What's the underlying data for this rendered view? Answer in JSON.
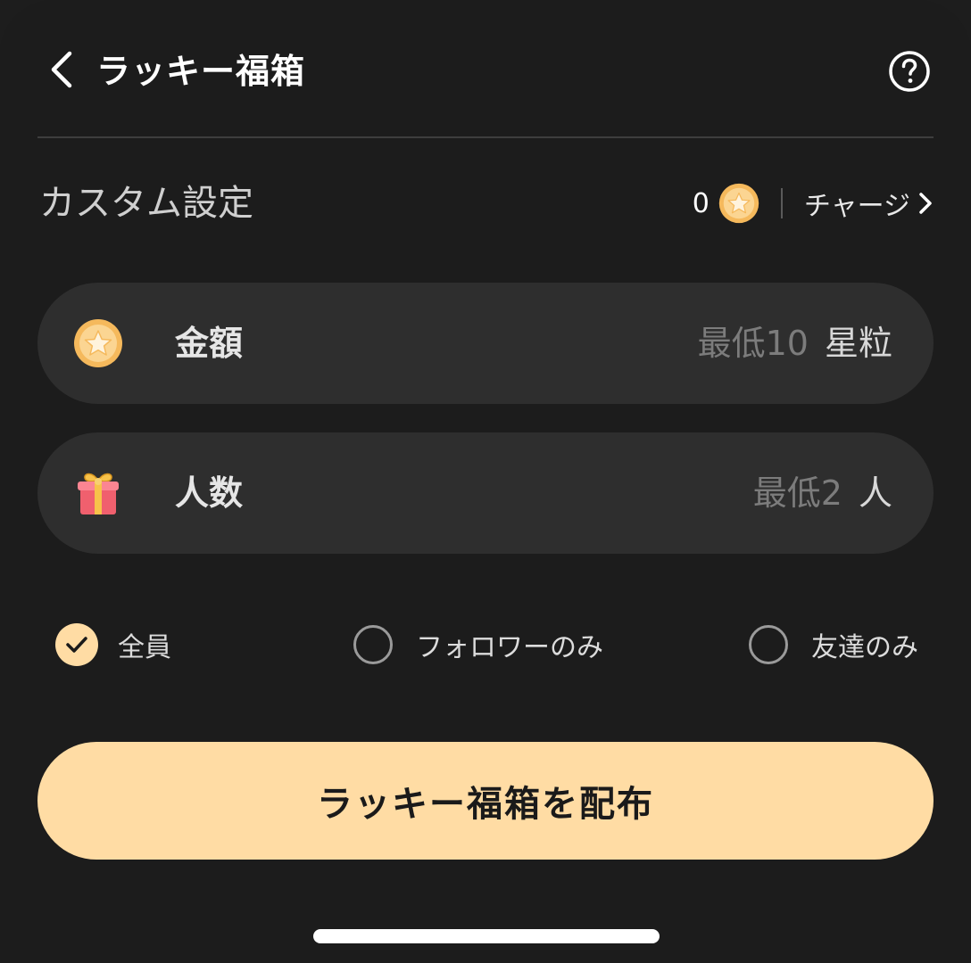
{
  "header": {
    "title": "ラッキー福箱",
    "back_icon": "chevron-left-icon",
    "help_icon": "question-circle-icon"
  },
  "settings": {
    "label": "カスタム設定",
    "balance": "0",
    "coin_icon": "star-coin-icon",
    "charge_label": "チャージ",
    "charge_icon": "chevron-right-icon"
  },
  "amount": {
    "icon": "star-coin-icon",
    "label": "金額",
    "placeholder": "最低10",
    "unit": "星粒"
  },
  "people": {
    "icon": "gift-box-icon",
    "label": "人数",
    "placeholder": "最低2",
    "unit": "人"
  },
  "audience": {
    "options": [
      {
        "label": "全員",
        "selected": true
      },
      {
        "label": "フォロワーのみ",
        "selected": false
      },
      {
        "label": "友達のみ",
        "selected": false
      }
    ]
  },
  "cta": {
    "label": "ラッキー福箱を配布"
  },
  "colors": {
    "background": "#1c1c1c",
    "pill": "#2e2e2e",
    "accent": "#ffdca4",
    "coin": "#f8c76a"
  }
}
